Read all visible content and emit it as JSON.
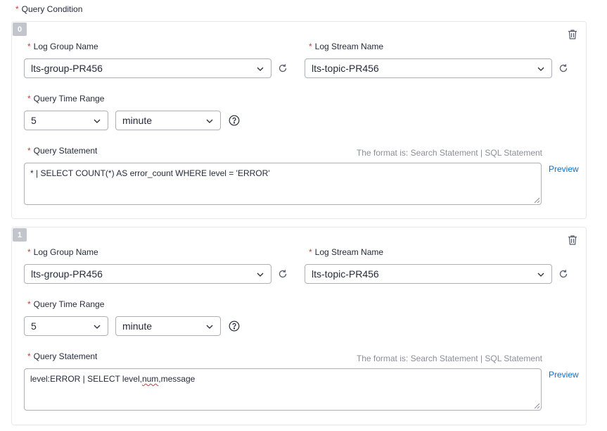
{
  "header": {
    "label": "Query Condition",
    "required_mark": "*"
  },
  "labels": {
    "log_group": "Log Group Name",
    "log_stream": "Log Stream Name",
    "time_range": "Query Time Range",
    "statement": "Query Statement",
    "format_hint": "The format is: Search Statement | SQL Statement",
    "preview": "Preview",
    "required_mark": "*"
  },
  "icons": {
    "delete": "trash-icon",
    "refresh": "refresh-icon",
    "dropdown": "chevron-down-icon",
    "help": "question-circle-icon",
    "resize": "resize-grip-icon"
  },
  "colors": {
    "required": "#e5303d",
    "link": "#0d6fc7",
    "badge": "#c2c6cc",
    "hint": "#8a8e99"
  },
  "conditions": [
    {
      "index": "0",
      "log_group": "lts-group-PR456",
      "log_stream": "lts-topic-PR456",
      "time_value": "5",
      "time_unit": "minute",
      "statement_parts": [
        "* | SELECT COUNT(*) AS error_count WHERE level = 'ERROR'",
        "",
        ""
      ]
    },
    {
      "index": "1",
      "log_group": "lts-group-PR456",
      "log_stream": "lts-topic-PR456",
      "time_value": "5",
      "time_unit": "minute",
      "statement_parts": [
        "level:ERROR | SELECT level,",
        "num",
        ",message"
      ]
    }
  ]
}
